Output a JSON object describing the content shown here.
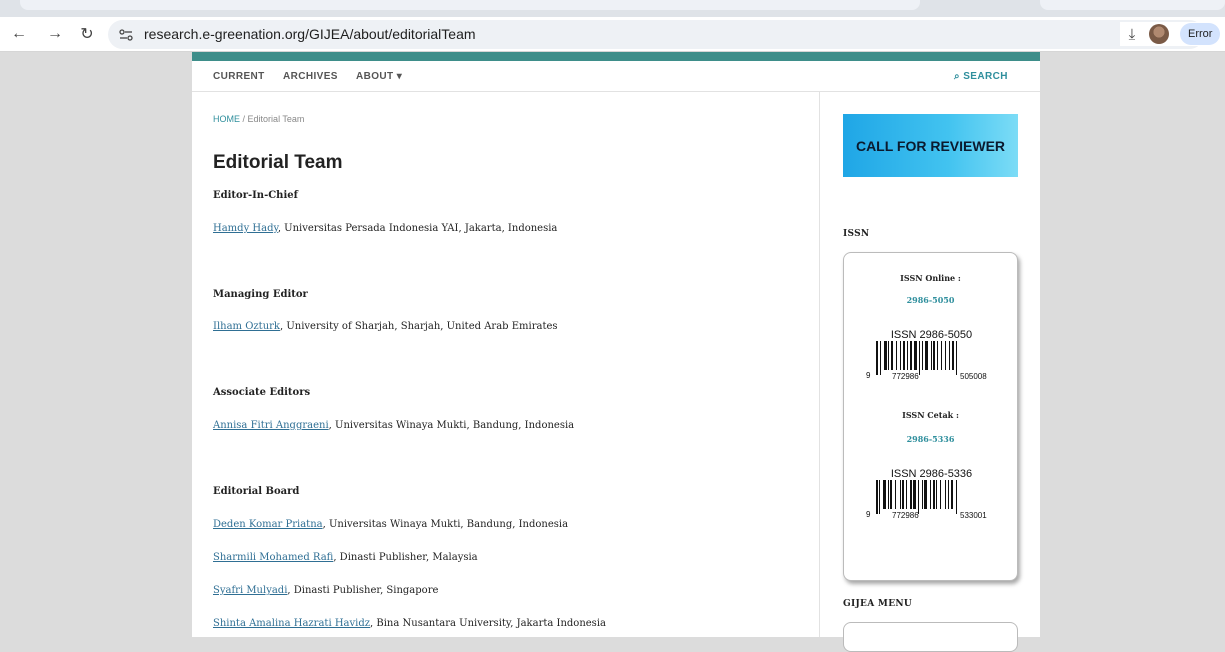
{
  "browser": {
    "url": "research.e-greenation.org/GIJEA/about/editorialTeam",
    "error_label": "Error"
  },
  "nav": {
    "current": "CURRENT",
    "archives": "ARCHIVES",
    "about": "ABOUT",
    "about_caret": "▾",
    "search": "SEARCH"
  },
  "breadcrumb": {
    "home": "HOME",
    "separator": "/",
    "current": "Editorial Team"
  },
  "page_title": "Editorial Team",
  "sections": {
    "editor_in_chief": {
      "heading": "Editor-In-Chief",
      "members": [
        {
          "name": "Hamdy Hady",
          "affiliation": ", Universitas Persada Indonesia YAI, Jakarta, Indonesia"
        }
      ]
    },
    "managing_editor": {
      "heading": "Managing Editor",
      "members": [
        {
          "name": "Ilham Ozturk",
          "affiliation": ", University of Sharjah, Sharjah, United Arab Emirates"
        }
      ]
    },
    "associate_editors": {
      "heading": "Associate Editors",
      "members": [
        {
          "name": "Annisa Fitri Anggraeni",
          "affiliation": ", Universitas Winaya Mukti, Bandung, Indonesia"
        }
      ]
    },
    "editorial_board": {
      "heading": "Editorial Board",
      "members": [
        {
          "name": "Deden Komar Priatna",
          "affiliation": ", Universitas Winaya Mukti, Bandung, Indonesia"
        },
        {
          "name": "Sharmili Mohamed Rafi",
          "affiliation": ", Dinasti Publisher, Malaysia"
        },
        {
          "name": "Syafri Mulyadi",
          "affiliation": ", Dinasti Publisher, Singapore"
        },
        {
          "name": "Shinta Amalina Hazrati Havidz",
          "affiliation": ", Bina Nusantara University, Jakarta Indonesia"
        }
      ]
    }
  },
  "sidebar": {
    "banner_text": "CALL FOR REVIEWER",
    "issn_title": "ISSN",
    "issn_online_label": "ISSN Online :",
    "issn_online_value": "2986-5050",
    "issn_online_barcode": {
      "title": "ISSN 2986-5050",
      "d1": "9",
      "d2": "772986",
      "d3": "505008"
    },
    "issn_print_label": "ISSN Cetak :",
    "issn_print_value": "2986-5336",
    "issn_print_barcode": {
      "title": "ISSN 2986-5336",
      "d1": "9",
      "d2": "772986",
      "d3": "533001"
    },
    "menu_title": "GIJEA MENU"
  },
  "colors": {
    "accent": "#3e8e8a",
    "link": "#2f6f94",
    "link_teal": "#2f8f9d"
  },
  "icons": [
    "back-arrow-icon",
    "forward-arrow-icon",
    "reload-icon",
    "site-info-icon",
    "zoom-icon",
    "star-icon",
    "download-icon",
    "profile-avatar",
    "search-icon",
    "chevron-down-icon"
  ]
}
